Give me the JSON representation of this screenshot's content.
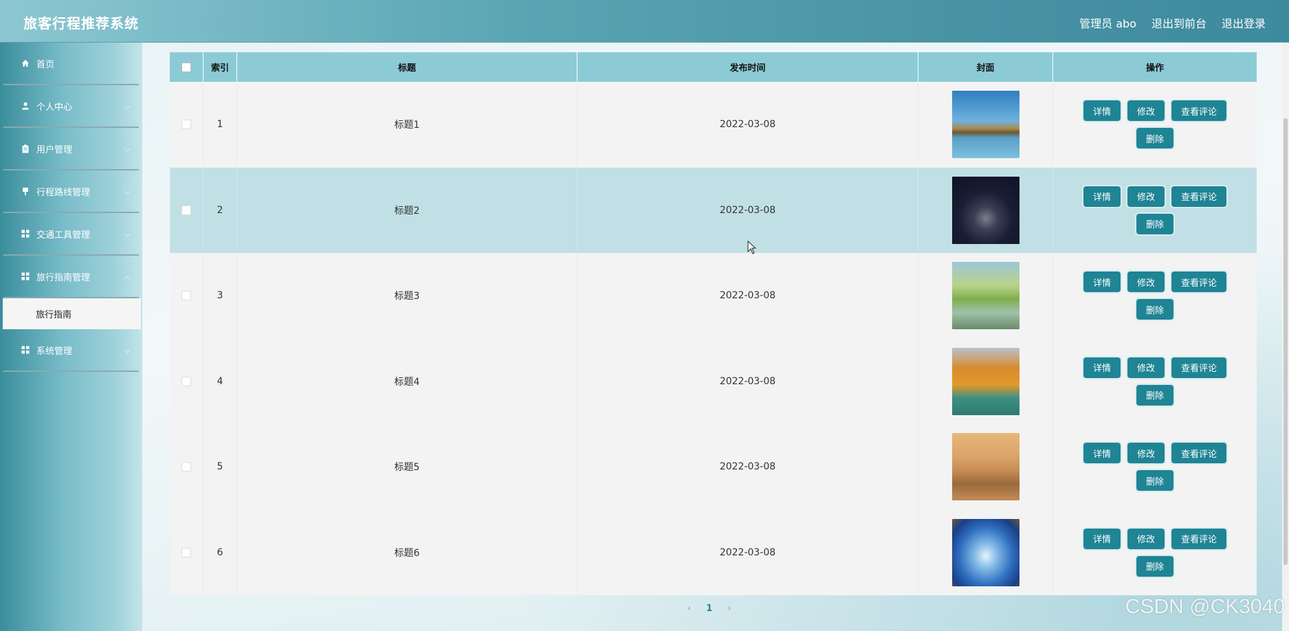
{
  "header": {
    "app_title": "旅客行程推荐系统",
    "user_label": "管理员 abo",
    "to_front": "退出到前台",
    "logout": "退出登录"
  },
  "sidebar": {
    "items": [
      {
        "label": "首页",
        "icon": "home-icon"
      },
      {
        "label": "个人中心",
        "icon": "person-icon"
      },
      {
        "label": "用户管理",
        "icon": "clipboard-icon"
      },
      {
        "label": "行程路线管理",
        "icon": "route-icon"
      },
      {
        "label": "交通工具管理",
        "icon": "grid-icon"
      },
      {
        "label": "旅行指南管理",
        "icon": "grid-icon"
      },
      {
        "label": "系统管理",
        "icon": "grid-icon"
      }
    ],
    "subitem": "旅行指南"
  },
  "table": {
    "headers": {
      "index": "索引",
      "title": "标题",
      "time": "发布时间",
      "cover": "封面",
      "ops": "操作"
    },
    "buttons": {
      "detail": "详情",
      "edit": "修改",
      "comments": "查看评论",
      "delete": "删除"
    },
    "rows": [
      {
        "index": "1",
        "title": "标题1",
        "time": "2022-03-08"
      },
      {
        "index": "2",
        "title": "标题2",
        "time": "2022-03-08"
      },
      {
        "index": "3",
        "title": "标题3",
        "time": "2022-03-08"
      },
      {
        "index": "4",
        "title": "标题4",
        "time": "2022-03-08"
      },
      {
        "index": "5",
        "title": "标题5",
        "time": "2022-03-08"
      },
      {
        "index": "6",
        "title": "标题6",
        "time": "2022-03-08"
      }
    ]
  },
  "pagination": {
    "prev": "‹",
    "current": "1",
    "next": "›"
  },
  "watermark": "CSDN @CK3040",
  "colors": {
    "accent": "#1f8494",
    "header_row": "#8ccbd6",
    "hover_row": "#c1e0e5"
  }
}
